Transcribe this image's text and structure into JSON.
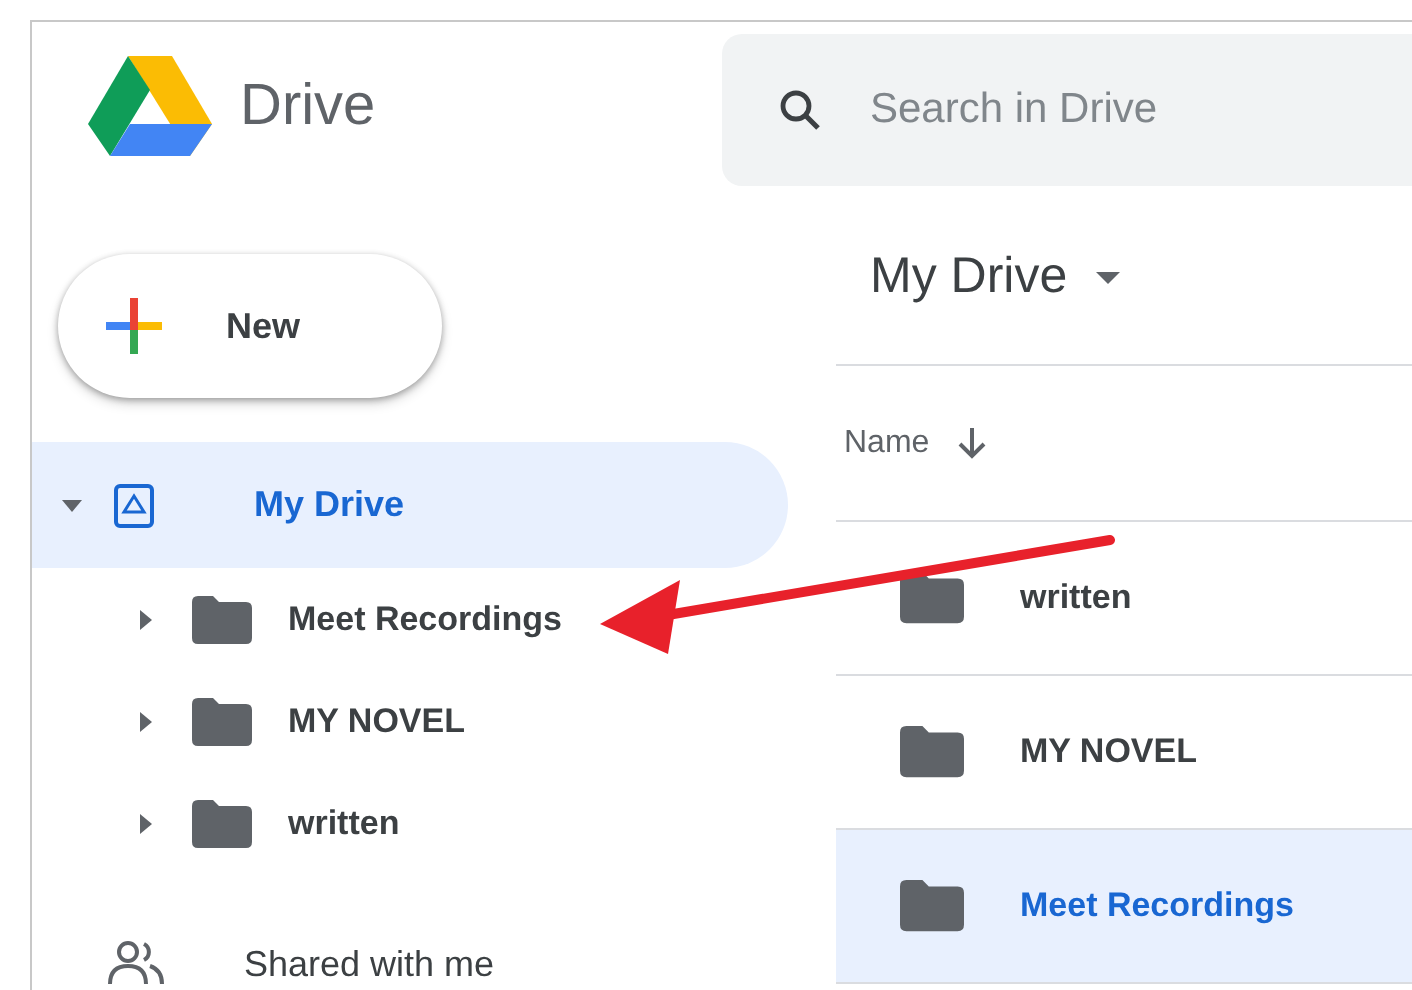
{
  "app": {
    "name": "Drive"
  },
  "search": {
    "placeholder": "Search in Drive"
  },
  "new_button": {
    "label": "New"
  },
  "sidebar": {
    "items": [
      {
        "label": "My Drive",
        "kind": "drive",
        "selected": true,
        "expanded": true,
        "children": [
          {
            "label": "Meet Recordings",
            "expanded": false
          },
          {
            "label": "MY NOVEL",
            "expanded": false
          },
          {
            "label": "written",
            "expanded": false
          }
        ]
      },
      {
        "label": "Shared with me",
        "kind": "shared",
        "selected": false
      }
    ]
  },
  "main": {
    "title": "My Drive",
    "sort_column": {
      "label": "Name"
    },
    "rows": [
      {
        "name": "written",
        "selected": false
      },
      {
        "name": "MY NOVEL",
        "selected": false
      },
      {
        "name": "Meet Recordings",
        "selected": true
      }
    ]
  },
  "annotation": {
    "kind": "arrow"
  }
}
